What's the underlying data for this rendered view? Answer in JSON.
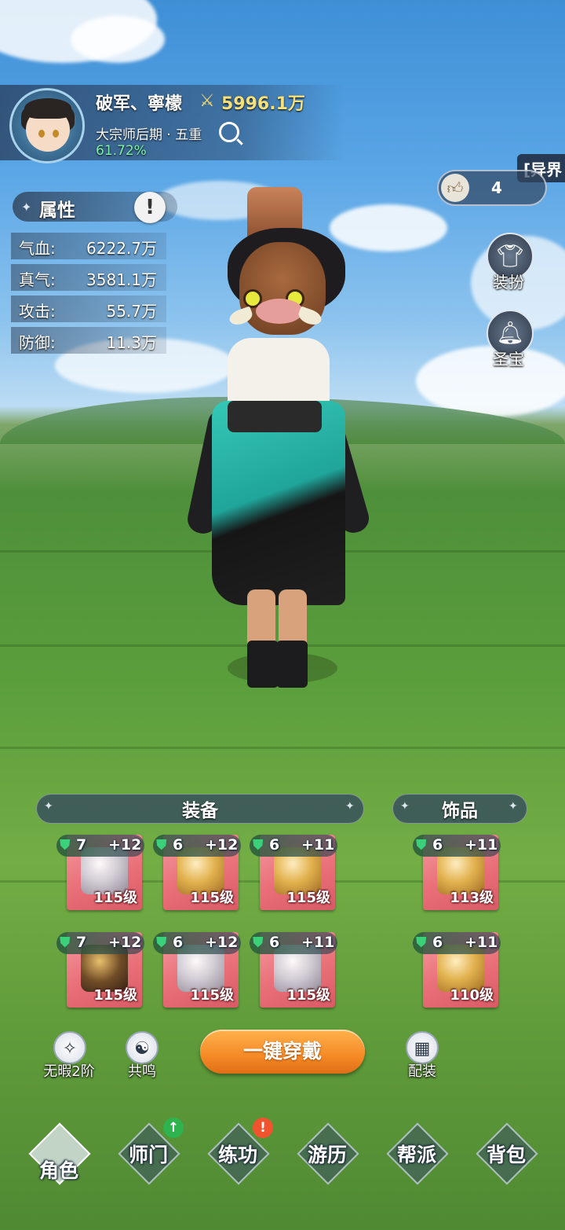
{
  "player": {
    "name": "破军、寧檬",
    "power": "5996.1万",
    "realm": "大宗师后期 · 五重",
    "progress": "61.72%"
  },
  "attributes": {
    "title": "属性",
    "info_icon": "!",
    "stats": [
      {
        "label": "气血:",
        "value": "6222.7万"
      },
      {
        "label": "真气:",
        "value": "3581.1万"
      },
      {
        "label": "攻击:",
        "value": "55.7万"
      },
      {
        "label": "防御:",
        "value": "11.3万"
      }
    ]
  },
  "side": {
    "realm_tag": "[异界",
    "likes": "4",
    "outfit_label": "装扮",
    "treasure_label": "圣宝"
  },
  "equipment": {
    "title": "装备",
    "slots": [
      {
        "gem": "7",
        "plus": "+12",
        "level": "115级",
        "item": "sword"
      },
      {
        "gem": "6",
        "plus": "+12",
        "level": "115级",
        "item": "helmet"
      },
      {
        "gem": "6",
        "plus": "+11",
        "level": "115级",
        "item": "armor"
      },
      {
        "gem": "7",
        "plus": "+12",
        "level": "115级",
        "item": "pants"
      },
      {
        "gem": "6",
        "plus": "+12",
        "level": "115级",
        "item": "bracer"
      },
      {
        "gem": "6",
        "plus": "+11",
        "level": "115级",
        "item": "boots"
      }
    ]
  },
  "accessories": {
    "title": "饰品",
    "slots": [
      {
        "gem": "6",
        "plus": "+11",
        "level": "113级",
        "item": "ring"
      },
      {
        "gem": "6",
        "plus": "+11",
        "level": "110级",
        "item": "amulet"
      }
    ]
  },
  "actions": {
    "flawless": "无暇2阶",
    "resonance": "共鸣",
    "equip_all": "一键穿戴",
    "loadout": "配装"
  },
  "nav": [
    {
      "label": "角色",
      "active": true
    },
    {
      "label": "师门",
      "badge": "up"
    },
    {
      "label": "练功",
      "badge": "alert"
    },
    {
      "label": "游历"
    },
    {
      "label": "帮派"
    },
    {
      "label": "背包"
    }
  ],
  "colors": {
    "power": "#f6e07a",
    "progress": "#7ef0a8",
    "slot_bg": "#e96f78",
    "equip_button": "#f58a26",
    "gem": "#3bd07a"
  }
}
